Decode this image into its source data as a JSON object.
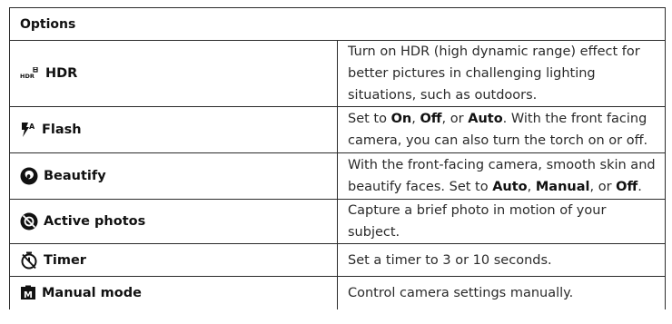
{
  "table": {
    "header": "Options",
    "rows": [
      {
        "name": "HDR",
        "icon": "hdr-icon",
        "icon_text": "HDR",
        "description": [
          {
            "text": "Turn on HDR (high dynamic range) effect for better pictures in challenging lighting situations, such as outdoors.",
            "bold": false
          }
        ]
      },
      {
        "name": "Flash",
        "icon": "flash-auto-icon",
        "icon_text": "A",
        "description": [
          {
            "text": "Set to ",
            "bold": false
          },
          {
            "text": "On",
            "bold": true
          },
          {
            "text": ", ",
            "bold": false
          },
          {
            "text": "Off",
            "bold": true
          },
          {
            "text": ", or ",
            "bold": false
          },
          {
            "text": "Auto",
            "bold": true
          },
          {
            "text": ". With the front facing camera, you can also turn the torch on or off.",
            "bold": false
          }
        ]
      },
      {
        "name": "Beautify",
        "icon": "beautify-icon",
        "description": [
          {
            "text": "With the front-facing camera, smooth skin and beautify faces. Set to ",
            "bold": false
          },
          {
            "text": "Auto",
            "bold": true
          },
          {
            "text": ", ",
            "bold": false
          },
          {
            "text": "Manual",
            "bold": true
          },
          {
            "text": ", or ",
            "bold": false
          },
          {
            "text": "Off",
            "bold": true
          },
          {
            "text": ".",
            "bold": false
          }
        ]
      },
      {
        "name": "Active photos",
        "icon": "active-photos-icon",
        "description": [
          {
            "text": "Capture a brief photo in motion of your subject.",
            "bold": false
          }
        ]
      },
      {
        "name": "Timer",
        "icon": "timer-icon",
        "description": [
          {
            "text": "Set a timer to 3 or 10 seconds.",
            "bold": false
          }
        ]
      },
      {
        "name": "Manual mode",
        "icon": "manual-mode-icon",
        "icon_text": "M",
        "description": [
          {
            "text": "Control camera settings manually.",
            "bold": false
          }
        ]
      }
    ]
  }
}
